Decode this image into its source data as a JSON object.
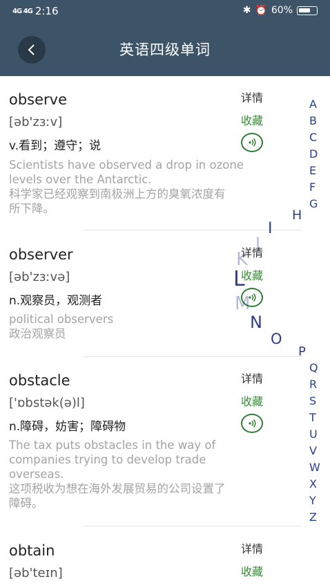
{
  "status": {
    "signal": "4G 4G",
    "time": "2:16",
    "icons": "bluetooth-icon alarm-icon 4g-icon",
    "battery": "60%"
  },
  "header": {
    "title": "英语四级单词",
    "back_icon": "back-icon"
  },
  "actions": {
    "details": "详情",
    "favorite": "收藏"
  },
  "entries": [
    {
      "word": "observe",
      "phonetic": "[əb'zɜːv]",
      "meaning": "v.看到；遵守；说",
      "example_en_1": "Scientists have observed a drop in ozone",
      "example_en_2": "levels over the Antarctic.",
      "example_zh_1": "科学家已经观察到南极洲上方的臭氧浓度有",
      "example_zh_2": "所下降。"
    },
    {
      "word": "observer",
      "phonetic": "[əb'zɜːvə]",
      "meaning": "n.观察员，观测者",
      "example_en_1": "political observers",
      "example_zh_1": "政治观察员"
    },
    {
      "word": "obstacle",
      "phonetic": "['ɒbstək(ə)l]",
      "meaning": "n.障碍，妨害；障碍物",
      "example_en_1": "The tax puts obstacles in the way of",
      "example_en_2": "companies trying to develop trade",
      "example_en_3": "overseas.",
      "example_zh_1": "这项税收为想在海外发展贸易的公司设置了",
      "example_zh_2": "障碍。"
    },
    {
      "word": "obtain",
      "phonetic": "[əb'teɪn]"
    }
  ],
  "alphabet": [
    "A",
    "B",
    "C",
    "D",
    "E",
    "F",
    "G",
    "H",
    "I",
    "J",
    "K",
    "L",
    "M",
    "N",
    "O",
    "P",
    "Q",
    "R",
    "S",
    "T",
    "U",
    "V",
    "W",
    "X",
    "Y",
    "Z"
  ],
  "colors": {
    "header_bg": "#3d5468",
    "accent_green": "#3a8a3a",
    "index_blue": "#2e3e88"
  }
}
